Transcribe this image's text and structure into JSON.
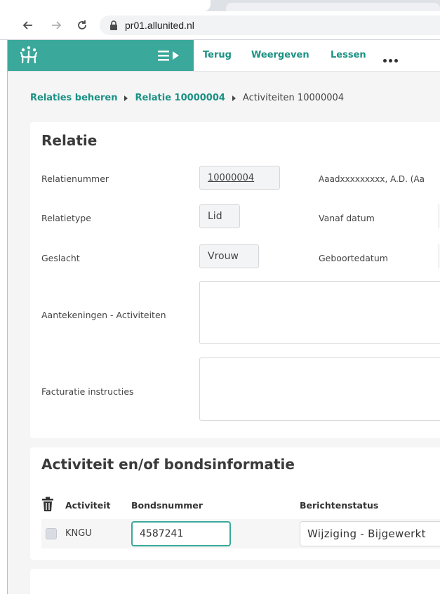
{
  "browser": {
    "url": "pr01.allunited.nl"
  },
  "app": {
    "colors": {
      "brand": "#3aa89a",
      "link": "#1a9183"
    },
    "nav": {
      "back_label": "Terug",
      "view_label": "Weergeven",
      "lessons_label": "Lessen"
    },
    "breadcrumb": {
      "items": [
        "Relaties beheren",
        "Relatie 10000004",
        "Activiteiten 10000004"
      ]
    },
    "relatie": {
      "title": "Relatie",
      "relatienummer_label": "Relatienummer",
      "relatienummer_value": "10000004",
      "name_text": "Aaadxxxxxxxxx, A.D. (Aa",
      "relatietype_label": "Relatietype",
      "relatietype_value": "Lid",
      "vanaf_label": "Vanaf datum",
      "geslacht_label": "Geslacht",
      "geslacht_value": "Vrouw",
      "geboorte_label": "Geboortedatum",
      "aantekeningen_label": "Aantekeningen - Activiteiten",
      "facturatie_label": "Facturatie instructies"
    },
    "activiteit": {
      "title": "Activiteit en/of bondsinformatie",
      "columns": [
        "Activiteit",
        "Bondsnummer",
        "Berichtenstatus"
      ],
      "rows": [
        {
          "activiteit": "KNGU",
          "bondsnummer": "4587241",
          "status": "Wijziging - Bijgewerkt"
        }
      ]
    }
  }
}
